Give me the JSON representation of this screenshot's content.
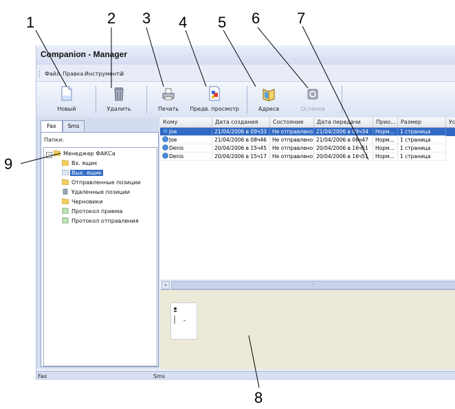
{
  "callouts": [
    "1",
    "2",
    "3",
    "4",
    "5",
    "6",
    "7",
    "8",
    "9"
  ],
  "window": {
    "title": "Companion - Manager"
  },
  "menu": [
    "Файл",
    "Правка",
    "Инструменты",
    "?"
  ],
  "toolbar": {
    "new": "Новый",
    "delete": "Удалить",
    "print": "Печать",
    "preview": "Предв. просмотр",
    "addresses": "Адреса",
    "stop": "Останов"
  },
  "tabs": [
    "Fax",
    "Sms"
  ],
  "folders": {
    "caption": "Папки:",
    "root": "Менеджер ФАКСа",
    "items": [
      "Вх. ящик",
      "Вых. ящик",
      "Отправленные позиции",
      "Удаленные позиции",
      "Черновики",
      "Протокол приема",
      "Протокол отправления"
    ],
    "selected": "Вых. ящик"
  },
  "table": {
    "columns": [
      "Кому",
      "Дата создания",
      "Состояние",
      "Дата передачи",
      "Прио...",
      "Размер",
      "Уст"
    ],
    "rows": [
      [
        "Joe",
        "21/04/2006 в 09ч33",
        "Не отправлено",
        "21/04/2006 в 09ч34",
        "Норм...",
        "1 страница"
      ],
      [
        "Joe",
        "21/04/2006 в 08ч46",
        "Не отправлено",
        "21/04/2006 в 08ч47",
        "Норм...",
        "1 страница"
      ],
      [
        "Denis",
        "20/04/2006 в 15ч45",
        "Не отправлено",
        "20/04/2006 в 16ч51",
        "Норм...",
        "1 страница"
      ],
      [
        "Denis",
        "20/04/2006 в 15ч17",
        "Не отправлено",
        "20/04/2006 в 16ч51",
        "Норм...",
        "1 страница"
      ]
    ]
  },
  "statusbar": [
    "Fax",
    "Sms"
  ],
  "colors": {
    "selection": "#316ac5",
    "panel": "#d3dcf0",
    "preview_bg": "#ece9d8"
  }
}
